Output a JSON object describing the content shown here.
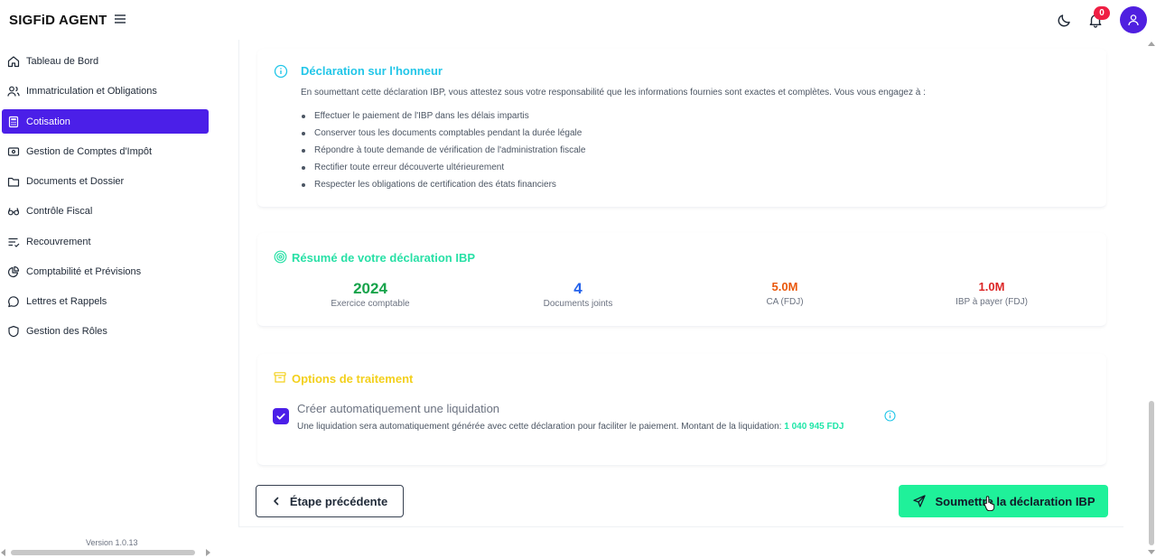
{
  "app": {
    "brand": "SIGFiD AGENT",
    "notifications_count": "0",
    "version": "Version 1.0.13"
  },
  "sidebar": {
    "items": [
      {
        "label": "Tableau de Bord",
        "icon": "home-icon",
        "active": false
      },
      {
        "label": "Immatriculation et Obligations",
        "icon": "users-icon",
        "active": false
      },
      {
        "label": "Cotisation",
        "icon": "calculator-icon",
        "active": true
      },
      {
        "label": "Gestion de Comptes d'Impôt",
        "icon": "wallet-icon",
        "active": false
      },
      {
        "label": "Documents et Dossier",
        "icon": "folder-icon",
        "active": false
      },
      {
        "label": "Contrôle Fiscal",
        "icon": "glasses-icon",
        "active": false
      },
      {
        "label": "Recouvrement",
        "icon": "list-check-icon",
        "active": false
      },
      {
        "label": "Comptabilité et Prévisions",
        "icon": "pie-chart-icon",
        "active": false
      },
      {
        "label": "Lettres et Rappels",
        "icon": "message-icon",
        "active": false
      },
      {
        "label": "Gestion des Rôles",
        "icon": "shield-icon",
        "active": false
      }
    ]
  },
  "declaration": {
    "title": "Déclaration sur l'honneur",
    "intro": "En soumettant cette déclaration IBP, vous attestez sous votre responsabilité que les informations fournies sont exactes et complètes. Vous vous engagez à :",
    "bullets": [
      "Effectuer le paiement de l'IBP dans les délais impartis",
      "Conserver tous les documents comptables pendant la durée légale",
      "Répondre à toute demande de vérification de l'administration fiscale",
      "Rectifier toute erreur découverte ultérieurement",
      "Respecter les obligations de certification des états financiers"
    ]
  },
  "summary": {
    "title": "Résumé de votre déclaration IBP",
    "stats": [
      {
        "value": "2024",
        "label": "Exercice comptable",
        "color": "#16a34a"
      },
      {
        "value": "4",
        "label": "Documents joints",
        "color": "#2563eb"
      },
      {
        "value": "5.0M",
        "label": "CA (FDJ)",
        "color": "#ea580c"
      },
      {
        "value": "1.0M",
        "label": "IBP à payer (FDJ)",
        "color": "#dc2626"
      }
    ]
  },
  "options": {
    "title": "Options de traitement",
    "checkbox_label": "Créer automatiquement une liquidation",
    "checked": true,
    "description": "Une liquidation sera automatiquement générée avec cette déclaration pour faciliter le paiement. Montant de la liquidation:",
    "amount": "1 040 945 FDJ"
  },
  "actions": {
    "prev_label": "Étape précédente",
    "submit_label": "Soumettre la déclaration IBP"
  },
  "colors": {
    "primary": "#4b1fe8",
    "submit": "#1ff19a",
    "cyan": "#22c6e8",
    "green": "#28e0a6",
    "yellow": "#f3d01c"
  }
}
